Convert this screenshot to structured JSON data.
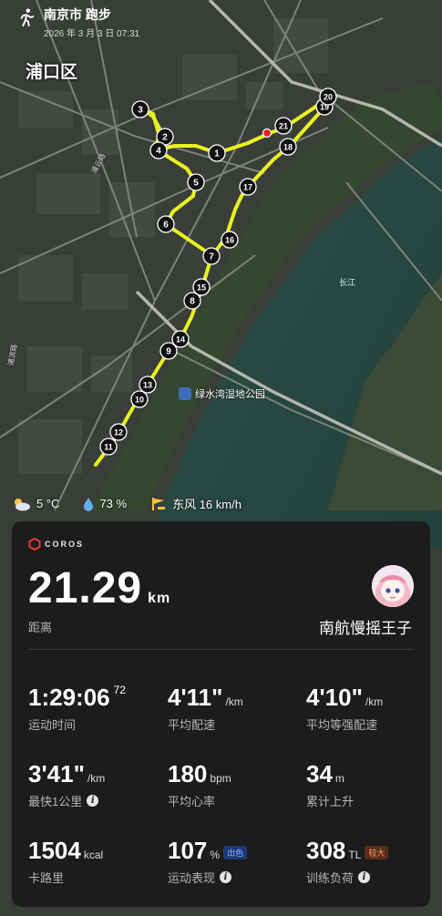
{
  "header": {
    "title": "南京市 跑步",
    "datetime": "2026 年 3 月 3 日 07:31"
  },
  "map": {
    "district": "浦口区",
    "park": "绿水湾湿地公园",
    "river": "长江",
    "roads": [
      "浦云路",
      "浦滨路"
    ],
    "route_color": "#e8f41e",
    "markers": [
      "1",
      "2",
      "3",
      "4",
      "5",
      "6",
      "7",
      "8",
      "9",
      "10",
      "11",
      "12",
      "13",
      "14",
      "15",
      "16",
      "17",
      "18",
      "19",
      "20",
      "21"
    ]
  },
  "weather": {
    "temperature": "5 °C",
    "humidity": "73 %",
    "wind": "东风 16 km/h"
  },
  "card": {
    "brand": "COROS",
    "distance": "21.29",
    "distance_unit": "km",
    "distance_label": "距离",
    "username": "南航慢摇王子",
    "stats": {
      "duration": {
        "value": "1:29:06",
        "sup": "72",
        "label": "运动时间"
      },
      "avg_pace": {
        "value": "4'11\"",
        "unit": "/km",
        "label": "平均配速"
      },
      "grade_pace": {
        "value": "4'10\"",
        "unit": "/km",
        "label": "平均等强配速"
      },
      "best_km": {
        "value": "3'41\"",
        "unit": "/km",
        "label": "最快1公里"
      },
      "avg_hr": {
        "value": "180",
        "unit": "bpm",
        "label": "平均心率"
      },
      "ascent": {
        "value": "34",
        "unit": "m",
        "label": "累计上升"
      },
      "calories": {
        "value": "1504",
        "unit": "kcal",
        "label": "卡路里"
      },
      "performance": {
        "value": "107",
        "unit": "%",
        "badge": "出色",
        "label": "运动表现"
      },
      "load": {
        "value": "308",
        "unit": "TL",
        "badge": "较大",
        "label": "训练负荷"
      }
    }
  }
}
